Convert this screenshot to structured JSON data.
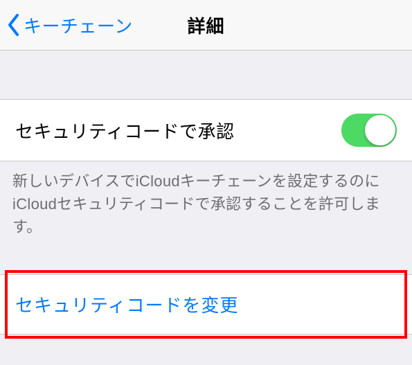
{
  "navbar": {
    "back_label": "キーチェーン",
    "title": "詳細"
  },
  "approve_row": {
    "label": "セキュリティコードで承認",
    "toggle_on": true
  },
  "footer": {
    "text": "新しいデバイスでiCloudキーチェーンを設定するのにiCloudセキュリティコードで承認することを許可します。"
  },
  "change_row": {
    "label": "セキュリティコードを変更"
  },
  "colors": {
    "accent": "#007aff",
    "toggle_on": "#4cd964",
    "highlight": "#ff0000"
  }
}
